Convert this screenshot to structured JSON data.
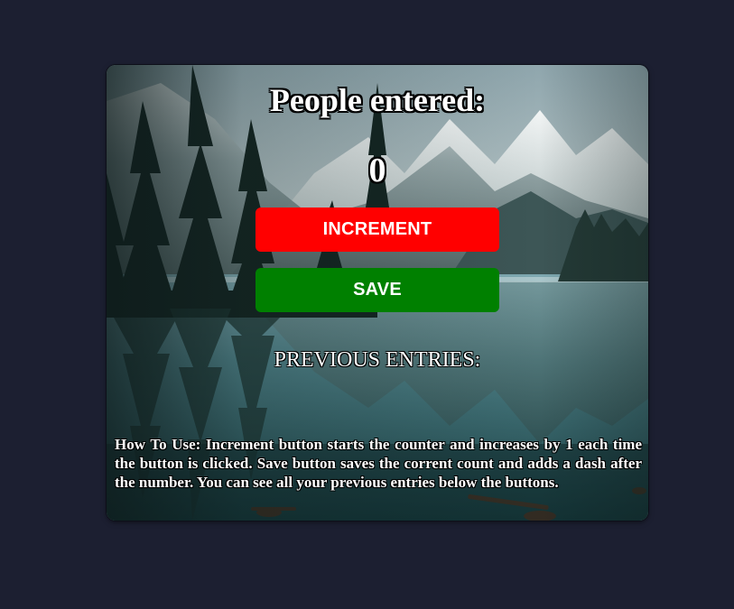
{
  "app": {
    "background_color": "#1c1f31"
  },
  "card": {
    "background_image": "mountain-lake-forest-landscape",
    "title": "People entered:",
    "count": "0",
    "buttons": {
      "increment_label": "INCREMENT",
      "increment_color": "#ff0000",
      "save_label": "SAVE",
      "save_color": "#008000"
    },
    "previous_entries_label": "PREVIOUS ENTRIES:",
    "how_to_text": "How To Use: Increment button starts the counter and increases by 1 each time the button is clicked. Save button saves the corrent count and adds a dash after the number. You can see all your previous entries below the buttons."
  }
}
